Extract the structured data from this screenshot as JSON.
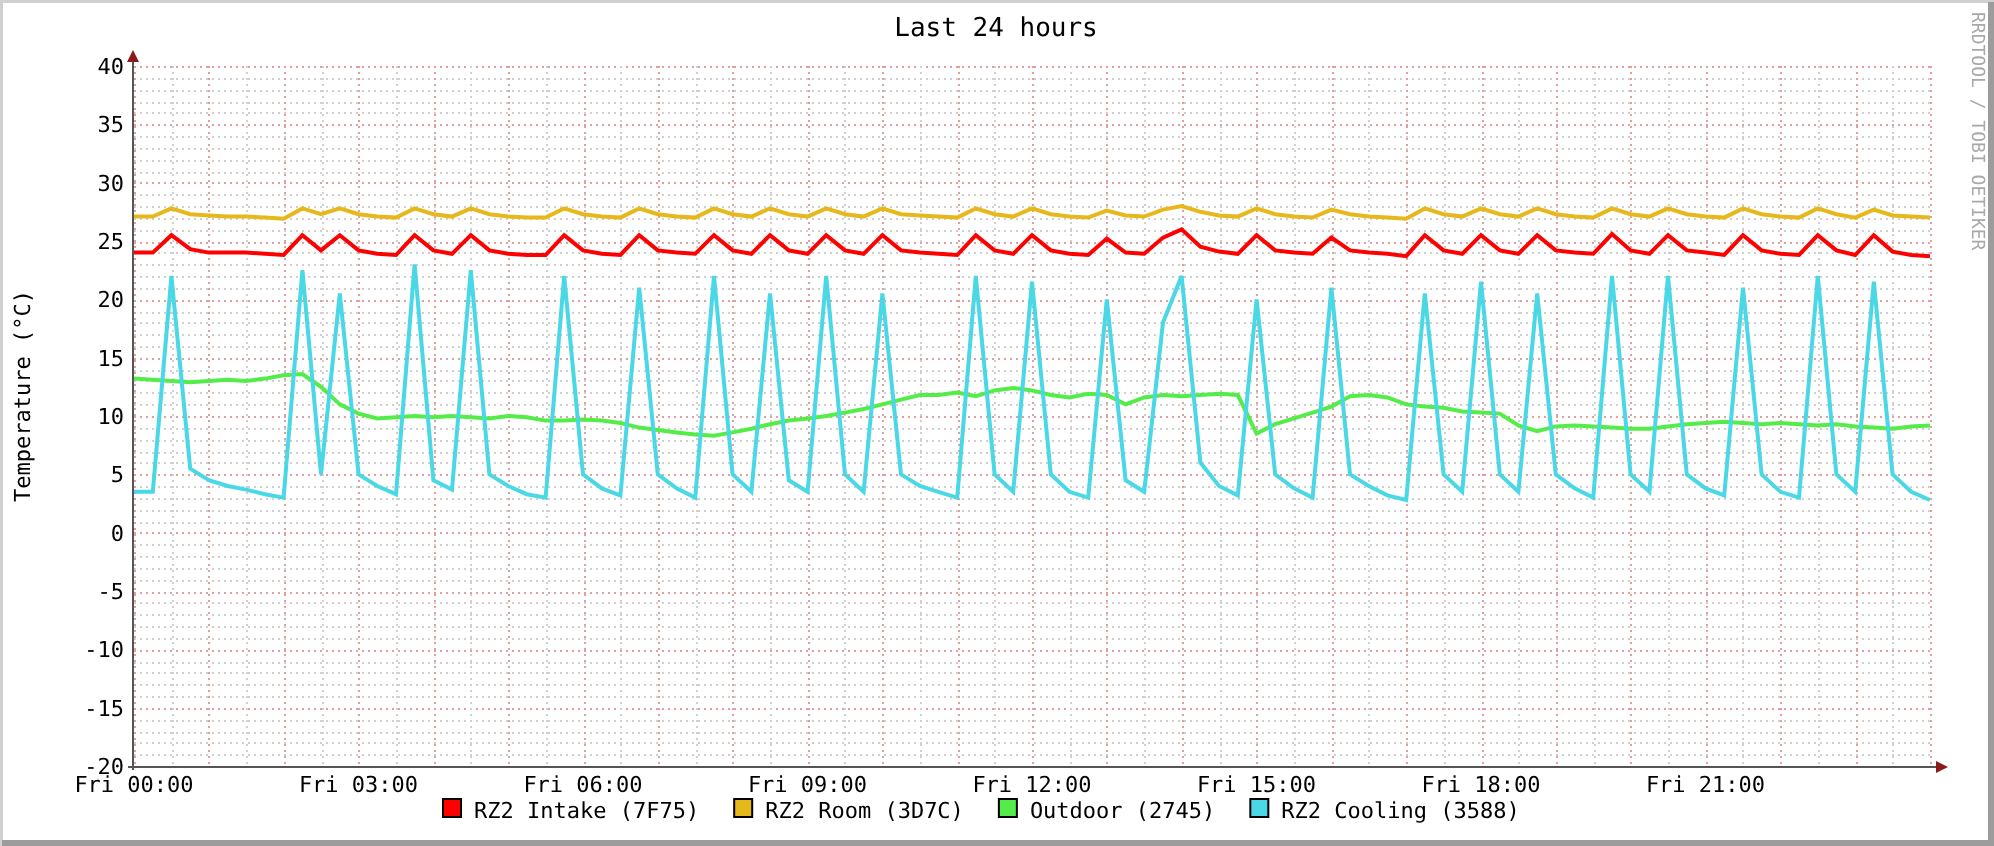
{
  "graph": {
    "credit": "RRDTOOL / TOBI OETIKER",
    "chart_data": {
      "type": "line",
      "title": "Last 24 hours",
      "ylabel": "Temperature (°C)",
      "ylim": [
        -20,
        40
      ],
      "grid": true,
      "legend": "bottom",
      "yticks": [
        -20,
        -15,
        -10,
        -5,
        0,
        5,
        10,
        15,
        20,
        25,
        30,
        35,
        40
      ],
      "categories": [
        "Fri 00:00",
        null,
        null,
        null,
        null,
        null,
        null,
        null,
        null,
        null,
        null,
        null,
        "Fri 03:00",
        null,
        null,
        null,
        null,
        null,
        null,
        null,
        null,
        null,
        null,
        null,
        "Fri 06:00",
        null,
        null,
        null,
        null,
        null,
        null,
        null,
        null,
        null,
        null,
        null,
        "Fri 09:00",
        null,
        null,
        null,
        null,
        null,
        null,
        null,
        null,
        null,
        null,
        null,
        "Fri 12:00",
        null,
        null,
        null,
        null,
        null,
        null,
        null,
        null,
        null,
        null,
        null,
        "Fri 15:00",
        null,
        null,
        null,
        null,
        null,
        null,
        null,
        null,
        null,
        null,
        null,
        "Fri 18:00",
        null,
        null,
        null,
        null,
        null,
        null,
        null,
        null,
        null,
        null,
        null,
        "Fri 21:00",
        null,
        null,
        null,
        null,
        null,
        null,
        null,
        null,
        null,
        null,
        null,
        null
      ],
      "series": [
        {
          "name": "RZ2 Intake (7F75)",
          "color": "#ff0000",
          "values": [
            24,
            24,
            25.5,
            24.3,
            24,
            24,
            24,
            23.9,
            23.8,
            25.5,
            24.2,
            25.5,
            24.2,
            23.9,
            23.8,
            25.5,
            24.2,
            23.9,
            25.5,
            24.2,
            23.9,
            23.8,
            23.8,
            25.5,
            24.2,
            23.9,
            23.8,
            25.5,
            24.2,
            24,
            23.9,
            25.5,
            24.2,
            23.9,
            25.5,
            24.2,
            23.9,
            25.5,
            24.2,
            23.9,
            25.5,
            24.2,
            24,
            23.9,
            23.8,
            25.5,
            24.2,
            23.9,
            25.5,
            24.2,
            23.9,
            23.8,
            25.2,
            24,
            23.9,
            25.3,
            26,
            24.5,
            24.1,
            23.9,
            25.5,
            24.2,
            24,
            23.9,
            25.3,
            24.2,
            24,
            23.9,
            23.7,
            25.5,
            24.2,
            23.9,
            25.5,
            24.2,
            23.9,
            25.5,
            24.2,
            24,
            23.9,
            25.6,
            24.2,
            23.9,
            25.5,
            24.2,
            24,
            23.8,
            25.5,
            24.2,
            23.9,
            23.8,
            25.5,
            24.2,
            23.8,
            25.5,
            24.1,
            23.8,
            23.7
          ]
        },
        {
          "name": "RZ2 Room (3D7C)",
          "color": "#e6b81c",
          "values": [
            27.1,
            27.1,
            27.8,
            27.3,
            27.2,
            27.1,
            27.1,
            27,
            26.9,
            27.8,
            27.3,
            27.8,
            27.3,
            27.1,
            27,
            27.8,
            27.3,
            27.1,
            27.8,
            27.3,
            27.1,
            27,
            27,
            27.8,
            27.3,
            27.1,
            27,
            27.8,
            27.3,
            27.1,
            27,
            27.8,
            27.3,
            27.1,
            27.8,
            27.3,
            27.1,
            27.8,
            27.3,
            27.1,
            27.8,
            27.3,
            27.2,
            27.1,
            27,
            27.8,
            27.3,
            27.1,
            27.8,
            27.3,
            27.1,
            27,
            27.6,
            27.2,
            27.1,
            27.7,
            28,
            27.5,
            27.2,
            27.1,
            27.8,
            27.3,
            27.1,
            27,
            27.7,
            27.3,
            27.1,
            27,
            26.9,
            27.8,
            27.3,
            27.1,
            27.8,
            27.3,
            27.1,
            27.8,
            27.3,
            27.1,
            27,
            27.8,
            27.3,
            27.1,
            27.8,
            27.3,
            27.1,
            27,
            27.8,
            27.3,
            27.1,
            27,
            27.8,
            27.3,
            27,
            27.7,
            27.2,
            27.1,
            27
          ]
        },
        {
          "name": "Outdoor (2745)",
          "color": "#54ec48",
          "values": [
            13.2,
            13.1,
            13,
            12.9,
            13,
            13.1,
            13,
            13.2,
            13.5,
            13.6,
            12.5,
            11,
            10.2,
            9.8,
            9.9,
            10,
            9.9,
            10,
            9.9,
            9.8,
            10,
            9.9,
            9.6,
            9.6,
            9.7,
            9.6,
            9.4,
            9,
            8.8,
            8.6,
            8.4,
            8.3,
            8.6,
            8.9,
            9.3,
            9.6,
            9.8,
            10,
            10.3,
            10.6,
            11,
            11.4,
            11.8,
            11.8,
            12,
            11.7,
            12.2,
            12.4,
            12.2,
            11.8,
            11.6,
            11.9,
            11.8,
            11,
            11.6,
            11.8,
            11.7,
            11.8,
            11.9,
            11.8,
            8.5,
            9.3,
            9.8,
            10.3,
            10.8,
            11.7,
            11.8,
            11.6,
            11,
            10.8,
            10.7,
            10.4,
            10.3,
            10.2,
            9.2,
            8.7,
            9.1,
            9.2,
            9.1,
            9,
            8.9,
            8.9,
            9.1,
            9.3,
            9.4,
            9.5,
            9.4,
            9.3,
            9.4,
            9.3,
            9.2,
            9.3,
            9.1,
            9,
            8.9,
            9.1,
            9.2
          ]
        },
        {
          "name": "RZ2 Cooling (3588)",
          "color": "#4ad8e6",
          "values": [
            3.5,
            3.5,
            22,
            5.5,
            4.5,
            4,
            3.7,
            3.3,
            3,
            22.5,
            5,
            20.5,
            5,
            4,
            3.3,
            23,
            4.5,
            3.7,
            22.5,
            5,
            4,
            3.3,
            3,
            22,
            5,
            3.8,
            3.2,
            21,
            5,
            3.8,
            3,
            22,
            5,
            3.5,
            20.5,
            4.5,
            3.5,
            22,
            5,
            3.5,
            20.5,
            5,
            4,
            3.5,
            3,
            22,
            5,
            3.5,
            21.5,
            5,
            3.5,
            3,
            20,
            4.5,
            3.5,
            18,
            22,
            6,
            4,
            3.2,
            20,
            5,
            3.8,
            3,
            21,
            5,
            4,
            3.2,
            2.8,
            20.5,
            5,
            3.5,
            21.5,
            5,
            3.5,
            20.5,
            5,
            3.8,
            3,
            22,
            5,
            3.5,
            22,
            5,
            3.8,
            3.2,
            21,
            5,
            3.5,
            3,
            22,
            5,
            3.5,
            21.5,
            5,
            3.5,
            2.8
          ]
        }
      ]
    }
  }
}
